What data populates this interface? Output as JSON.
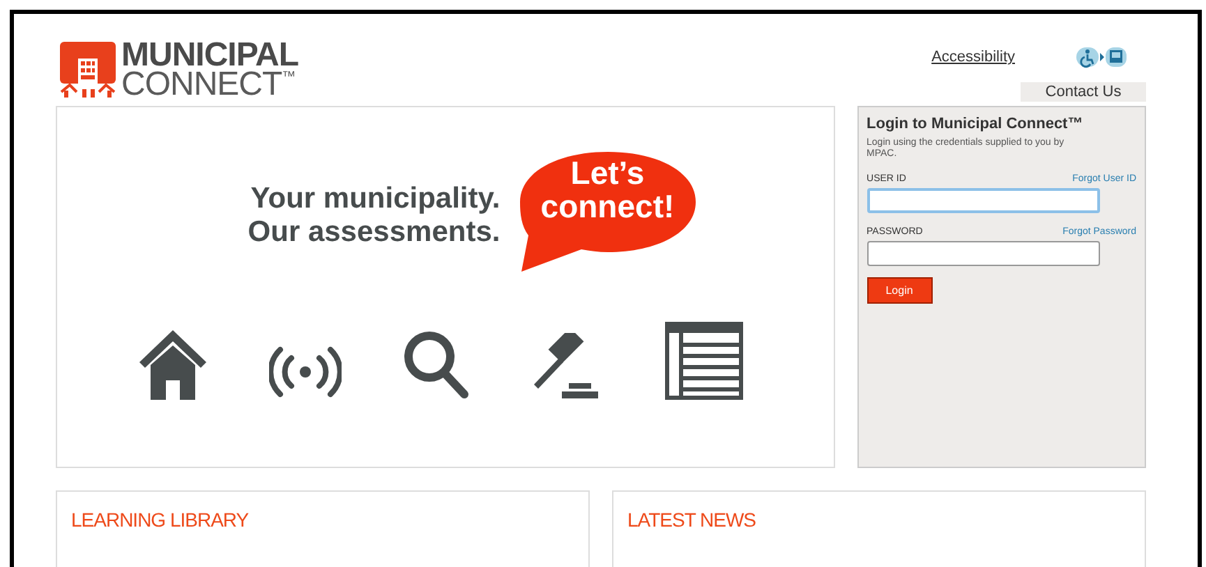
{
  "logo": {
    "line_1": "MUNICIPAL",
    "line_2": "CONNECT",
    "mark": "™"
  },
  "header": {
    "accessibility_link": "Accessibility",
    "contact_button": "Contact Us"
  },
  "hero": {
    "tagline_1": "Your municipality.",
    "tagline_2": "Our assessments.",
    "bubble_1": "Let’s",
    "bubble_2": "connect!"
  },
  "login": {
    "title": "Login to Municipal Connect™",
    "intro": "Login using the credentials supplied to you by MPAC.",
    "fields": [
      {
        "label": "USER ID",
        "link": "Forgot User ID",
        "focused": true
      },
      {
        "label": "PASSWORD",
        "link": "Forgot Password",
        "focused": false
      }
    ],
    "button": "Login"
  },
  "sections": [
    {
      "title": "LEARNING LIBRARY"
    },
    {
      "title": "LATEST NEWS"
    }
  ]
}
